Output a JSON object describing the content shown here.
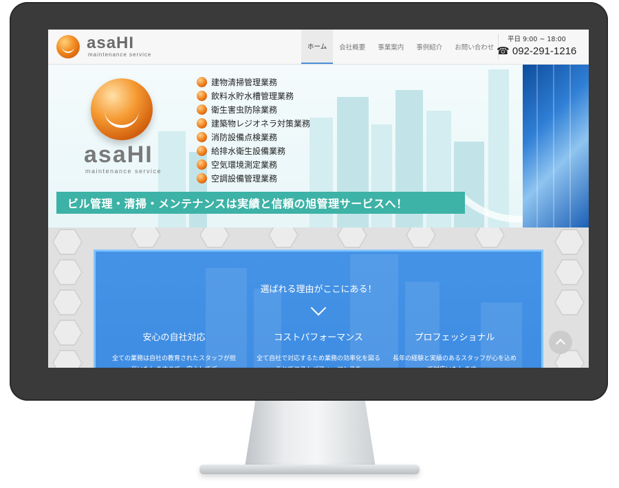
{
  "header": {
    "logo_text": "asaHI",
    "logo_sub": "maintenance service",
    "nav": [
      "ホーム",
      "会社概要",
      "事業案内",
      "事例紹介",
      "お問い合わせ"
    ],
    "hours": "平日 9:00 ~ 18:00",
    "phone": "☎ 092-291-1216"
  },
  "hero": {
    "logo_text": "asaHI",
    "logo_sub": "maintenance service",
    "services": [
      "建物清掃管理業務",
      "飲料水貯水槽管理業務",
      "衛生害虫防除業務",
      "建築物レジオネラ対策業務",
      "消防設備点検業務",
      "給排水衛生設備業務",
      "空気環境測定業務",
      "空調設備管理業務"
    ],
    "banner": "ビル管理・清掃・メンテナンスは実績と信頼の旭管理サービスへ！"
  },
  "reasons": {
    "title": "選ばれる理由がここにある！",
    "columns": [
      {
        "title": "安心の自社対応",
        "text": "全ての業務は自社の教育されたスタッフが担当いたしますので、安心してご"
      },
      {
        "title": "コストパフォーマンス",
        "text": "全て自社で対応するため業務の効率化を図ることでコストパフォーマンスを"
      },
      {
        "title": "プロフェッショナル",
        "text": "長年の経験と実績のあるスタッフが心を込めて対応いたします。"
      }
    ]
  },
  "colors": {
    "accent_blue": "#4593e6",
    "banner_teal": "#3db2a6",
    "brand_orange": "#ee7d1a"
  }
}
